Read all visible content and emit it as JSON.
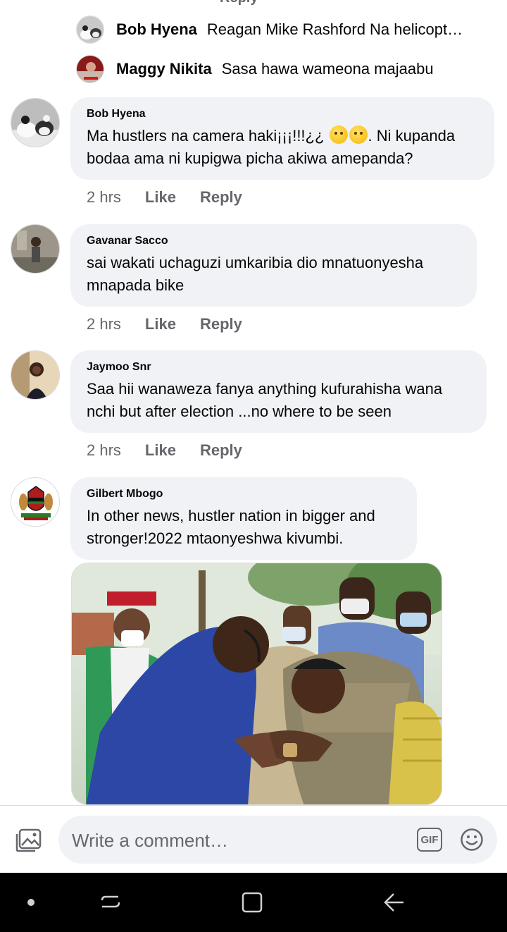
{
  "clipped_reply_label": "Reply",
  "reply_previews": [
    {
      "name": "Bob Hyena",
      "text": "Reagan Mike Rashford Na helicopt…"
    },
    {
      "name": "Maggy Nikita",
      "text": "Sasa hawa wameona majaabu"
    }
  ],
  "comments": [
    {
      "author": "Bob Hyena",
      "text_before_emoji": "Ma hustlers na camera haki¡¡¡!!!¿¿ ",
      "text_after_emoji": ". Ni kupanda bodaa ama ni kupigwa picha akiwa amepanda?",
      "time": "2 hrs",
      "like": "Like",
      "reply": "Reply"
    },
    {
      "author": "Gavanar Sacco",
      "text": "sai wakati uchaguzi umkaribia dio mnatuonyesha mnapada bike",
      "time": "2 hrs",
      "like": "Like",
      "reply": "Reply"
    },
    {
      "author": "Jaymoo Snr",
      "text": "Saa hii wanaweza fanya anything kufurahisha wana nchi but  after election ...no where to be seen",
      "time": "2 hrs",
      "like": "Like",
      "reply": "Reply"
    },
    {
      "author": "Gilbert Mbogo",
      "text": "In other news, hustler nation in bigger and stronger!2022 mtaonyeshwa kivumbi."
    }
  ],
  "composer": {
    "placeholder": "Write a comment…",
    "gif_label": "GIF"
  },
  "icons": {
    "photo": "photo-attach-icon",
    "gif": "gif-icon",
    "emoji": "emoji-icon",
    "nav_recent": "recent-apps-icon",
    "nav_home": "home-icon",
    "nav_back": "back-icon"
  },
  "colors": {
    "bubble": "#f0f2f5",
    "secondary_text": "#65676b",
    "nav_bar": "#000000"
  }
}
